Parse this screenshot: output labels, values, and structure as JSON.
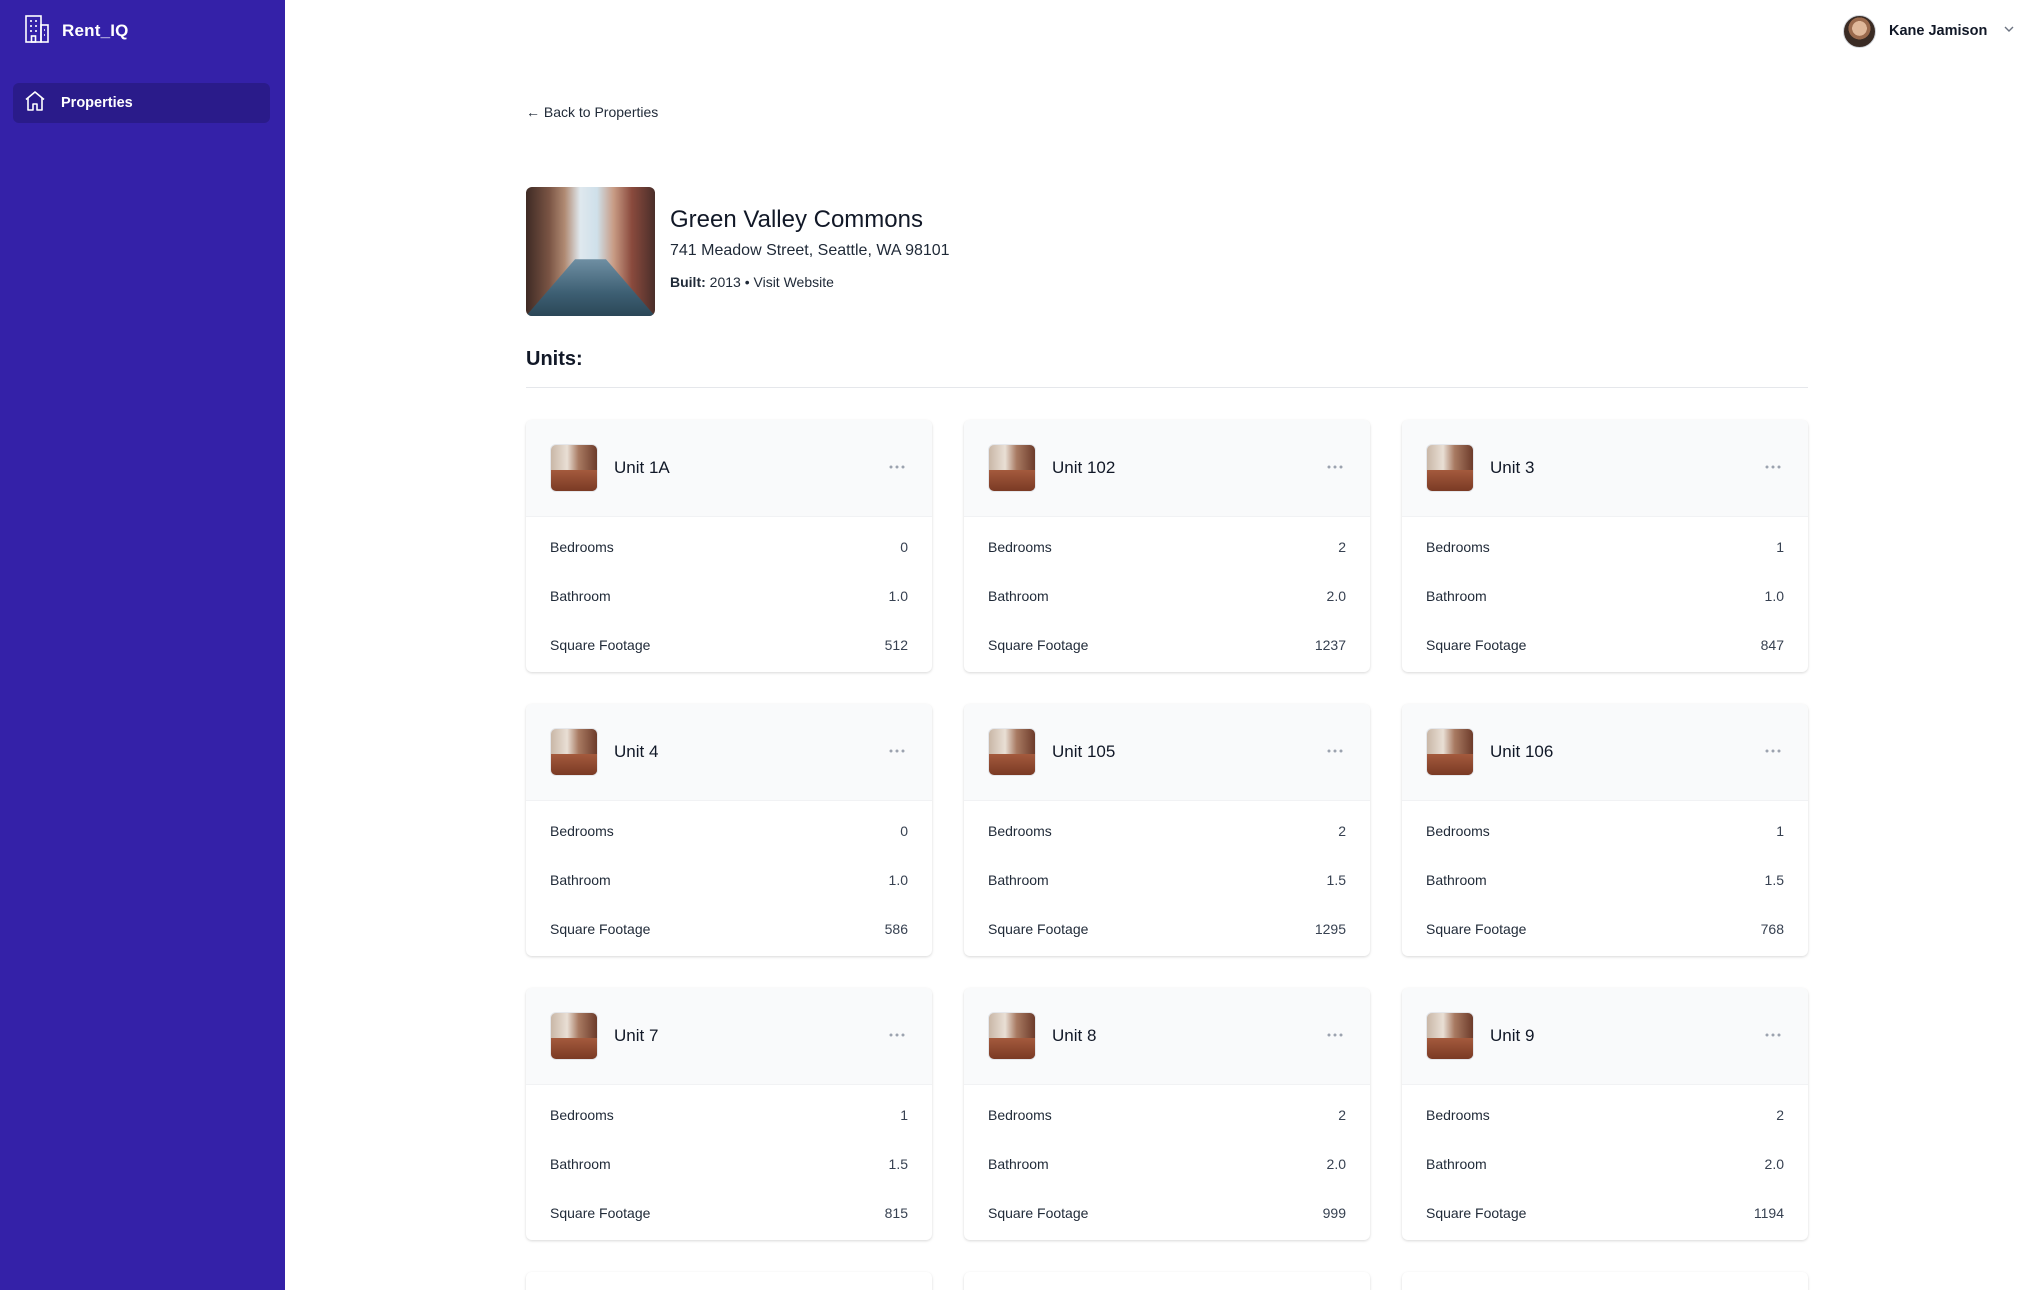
{
  "app": {
    "name": "Rent_IQ"
  },
  "sidebar": {
    "items": [
      {
        "label": "Properties",
        "icon": "home-icon"
      }
    ]
  },
  "header": {
    "user_name": "Kane Jamison"
  },
  "back_link": "← Back to Properties",
  "property": {
    "name": "Green Valley Commons",
    "address": "741 Meadow Street, Seattle, WA 98101",
    "built_label": "Built:",
    "built_year": "2013",
    "separator": "•",
    "website_link": "Visit Website"
  },
  "units_heading": "Units:",
  "labels": {
    "bedrooms": "Bedrooms",
    "bathroom": "Bathroom",
    "sqft": "Square Footage"
  },
  "units": [
    {
      "name": "Unit 1A",
      "bedrooms": "0",
      "bathroom": "1.0",
      "sqft": "512"
    },
    {
      "name": "Unit 102",
      "bedrooms": "2",
      "bathroom": "2.0",
      "sqft": "1237"
    },
    {
      "name": "Unit 3",
      "bedrooms": "1",
      "bathroom": "1.0",
      "sqft": "847"
    },
    {
      "name": "Unit 4",
      "bedrooms": "0",
      "bathroom": "1.0",
      "sqft": "586"
    },
    {
      "name": "Unit 105",
      "bedrooms": "2",
      "bathroom": "1.5",
      "sqft": "1295"
    },
    {
      "name": "Unit 106",
      "bedrooms": "1",
      "bathroom": "1.5",
      "sqft": "768"
    },
    {
      "name": "Unit 7",
      "bedrooms": "1",
      "bathroom": "1.5",
      "sqft": "815"
    },
    {
      "name": "Unit 8",
      "bedrooms": "2",
      "bathroom": "2.0",
      "sqft": "999"
    },
    {
      "name": "Unit 9",
      "bedrooms": "2",
      "bathroom": "2.0",
      "sqft": "1194"
    }
  ],
  "colors": {
    "sidebar": "#3421a8",
    "sidebar_active": "#2a1b8a"
  }
}
